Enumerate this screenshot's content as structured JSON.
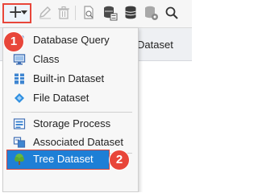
{
  "toolbar": {
    "buttons": [
      {
        "icon": "add-icon"
      },
      {
        "icon": "edit-icon"
      },
      {
        "icon": "delete-icon"
      },
      {
        "icon": "preview-icon"
      },
      {
        "icon": "database-settings-icon"
      },
      {
        "icon": "database-icon"
      },
      {
        "icon": "database-gear-icon"
      },
      {
        "icon": "search-icon"
      }
    ]
  },
  "background": {
    "column_header": "Dataset"
  },
  "menu": {
    "items": [
      {
        "label": "Database Query",
        "icon": "database-query-icon"
      },
      {
        "label": "Class",
        "icon": "class-icon"
      },
      {
        "label": "Built-in Dataset",
        "icon": "builtin-dataset-icon"
      },
      {
        "label": "File Dataset",
        "icon": "file-dataset-icon"
      },
      {
        "label": "Storage Process",
        "icon": "storage-process-icon"
      },
      {
        "label": "Associated Dataset",
        "icon": "associated-dataset-icon"
      },
      {
        "label": "Tree Dataset",
        "icon": "tree-icon",
        "selected": true
      }
    ]
  },
  "annotations": {
    "badge1": "1",
    "badge2": "2"
  },
  "colors": {
    "highlight_red": "#e8463a",
    "selection_blue": "#1e7fd6"
  }
}
